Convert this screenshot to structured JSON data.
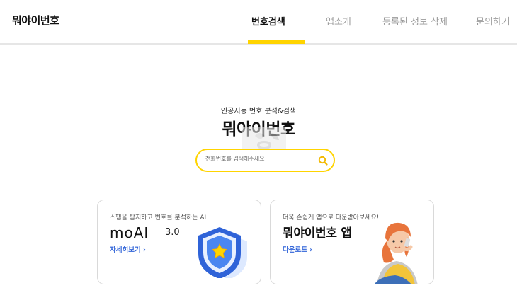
{
  "header": {
    "logo": "뭐야이번호",
    "nav": [
      {
        "label": "번호검색",
        "active": true
      },
      {
        "label": "앱소개",
        "active": false
      },
      {
        "label": "등록된 정보 삭제",
        "active": false
      },
      {
        "label": "문의하기",
        "active": false
      }
    ]
  },
  "hero": {
    "subtitle": "인공지능 번호 분석&검색",
    "title": "뭐야이번호",
    "search": {
      "placeholder": "전화번호를 검색해주세요",
      "value": ""
    }
  },
  "cards": [
    {
      "desc": "스팸을 탐지하고 번호를 분석하는 AI",
      "title": "moAI",
      "version": "3.0",
      "link": "자세히보기 ›",
      "icon": "shield-star-icon"
    },
    {
      "desc": "더욱 손쉽게 앱으로 다운받아보세요!",
      "title": "뭐야이번호 앱",
      "link": "다운로드 ›",
      "icon": "woman-phone-illustration"
    }
  ],
  "colors": {
    "accent": "#ffd400",
    "link": "#2f63d8",
    "nav_inactive": "#9a9a9a"
  }
}
